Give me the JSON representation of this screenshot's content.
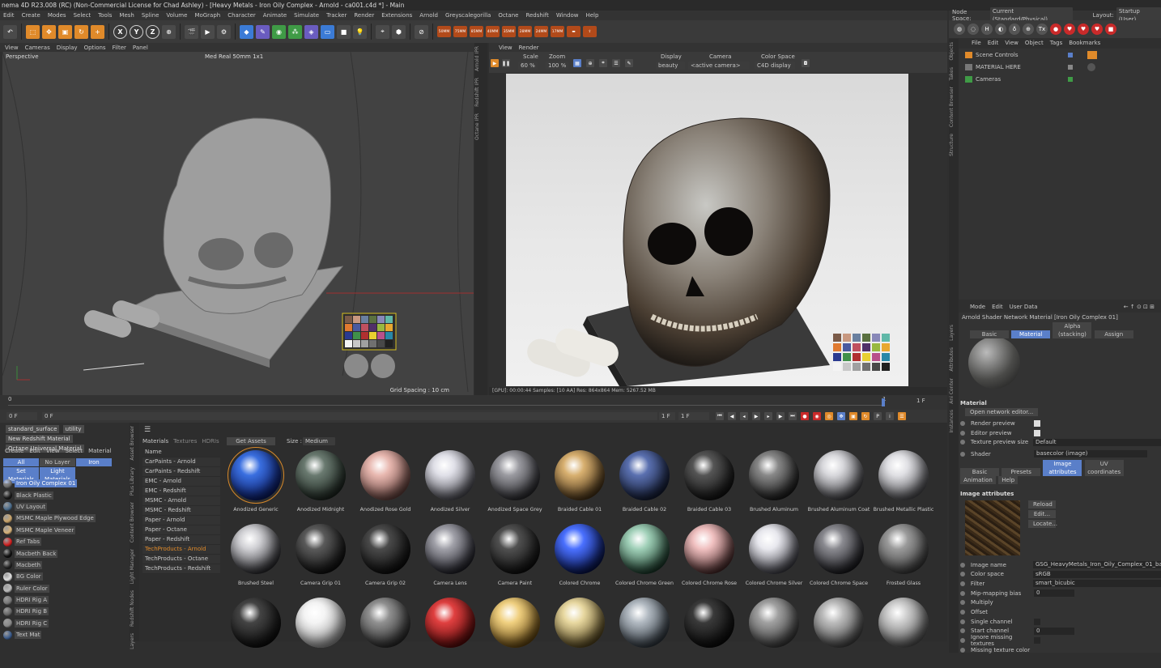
{
  "title": "nema 4D R23.008 (RC) (Non-Commercial License for Chad Ashley) - [Heavy Metals - Iron Oily Complex - Arnold - ca001.c4d *] - Main",
  "menu": [
    "Edit",
    "Create",
    "Modes",
    "Select",
    "Tools",
    "Mesh",
    "Spline",
    "Volume",
    "MoGraph",
    "Character",
    "Animate",
    "Simulate",
    "Tracker",
    "Render",
    "Extensions",
    "Arnold",
    "Greyscalegorilla",
    "Octane",
    "Redshift",
    "Window",
    "Help"
  ],
  "nodespace": {
    "label": "Node Space:",
    "value": "Current (Standard/Physical)",
    "layout_label": "Layout:",
    "layout_value": "Startup (User)"
  },
  "toolbar": {
    "axes": [
      "X",
      "Y",
      "Z"
    ],
    "render_presets": [
      "50MM",
      "75MM",
      "85MM",
      "40MM",
      "35MM",
      "28MM",
      "24MM",
      "17MM"
    ]
  },
  "viewport": {
    "menu": [
      "View",
      "Cameras",
      "Display",
      "Options",
      "Filter",
      "Panel"
    ],
    "label": "Perspective",
    "camera": "Med Real 50mm 1x1",
    "grid": "Grid Spacing : 10 cm"
  },
  "left_vtabs": [
    "Arnold IPR",
    "Redshift IPR",
    "Octane IPR"
  ],
  "render_view": {
    "menu": [
      "View",
      "Render"
    ],
    "scale_label": "Scale",
    "scale_value": "60 %",
    "zoom_label": "Zoom",
    "zoom_value": "100 %",
    "display_label": "Display",
    "display_value": "beauty",
    "camera_label": "Camera",
    "camera_value": "<active camera>",
    "colorspace_label": "Color Space",
    "colorspace_value": "C4D display",
    "status": "[GPU]: 00:00:44   Samples: [10 AA]   Res: 864x864   Mem: 5267.52 MB"
  },
  "timeline": {
    "start": "0",
    "end": "1",
    "frame_left": "0 F",
    "frame_l2": "0 F",
    "frame_r1": "1 F",
    "frame_r2": "1 F",
    "frame_top": "1 F"
  },
  "mm_top": {
    "chips": [
      "standard_surface",
      "utility",
      "New Redshift Material",
      "Octane Universal Material"
    ]
  },
  "mm_menu": [
    "Create",
    "Edit",
    "View",
    "Select",
    "Material"
  ],
  "mm_filter": {
    "row1": [
      "All",
      "No Layer",
      "Iron"
    ],
    "row2": [
      "Set Materials",
      "Light Materials"
    ]
  },
  "materials": [
    {
      "name": "Iron Oily Complex 01",
      "color": "#6b6b6b",
      "selected": true
    },
    {
      "name": "Black Plastic",
      "color": "#1a1a1a"
    },
    {
      "name": "UV Layout",
      "color": "#4a6b8a"
    },
    {
      "name": "MSMC Maple Plywood Edge",
      "color": "#c9a46a"
    },
    {
      "name": "MSMC Maple Veneer",
      "color": "#d8b47a"
    },
    {
      "name": "Ref Tabs",
      "color": "#d02020"
    },
    {
      "name": "Macbeth Back",
      "color": "#111111"
    },
    {
      "name": "Macbeth",
      "color": "#222222"
    },
    {
      "name": "BG Color",
      "color": "#e0e0e0"
    },
    {
      "name": "Ruler Color",
      "color": "#bbbbbb"
    },
    {
      "name": "HDRI Rig A",
      "color": "#777777"
    },
    {
      "name": "HDRI Rig B",
      "color": "#666666"
    },
    {
      "name": "HDRI Rig C",
      "color": "#888888"
    },
    {
      "name": "Text Mat",
      "color": "#3a5a8a"
    }
  ],
  "mm_vtabs": [
    "Asset Browser",
    "Plus Library",
    "Content Browser",
    "Light Manager",
    "Redshift Nodes",
    "Layers"
  ],
  "asset_browser": {
    "tabs": [
      "Materials",
      "Textures",
      "HDRIs"
    ],
    "get_assets": "Get Assets",
    "size_label": "Size :",
    "size_value": "Medium",
    "tree_header": "Name",
    "tree": [
      "CarPaints - Arnold",
      "CarPaints - Redshift",
      "EMC - Arnold",
      "EMC - Redshift",
      "MSMC - Arnold",
      "MSMC - Redshift",
      "Paper - Arnold",
      "Paper - Octane",
      "Paper - Redshift",
      "TechProducts - Arnold",
      "TechProducts - Octane",
      "TechProducts - Redshift"
    ],
    "tiles": [
      {
        "label": "Anodized Generic",
        "c1": "#3a6fe0",
        "c2": "#0a1a66"
      },
      {
        "label": "Anodized Midnight",
        "c1": "#6a7a70",
        "c2": "#1d2620"
      },
      {
        "label": "Anodized Rose Gold",
        "c1": "#e8b8b0",
        "c2": "#6a4540"
      },
      {
        "label": "Anodized Silver",
        "c1": "#e0e0e8",
        "c2": "#505058"
      },
      {
        "label": "Anodized Space Grey",
        "c1": "#9a9aa0",
        "c2": "#2a2a2e"
      },
      {
        "label": "Braided Cable 01",
        "c1": "#d8b070",
        "c2": "#4a3418"
      },
      {
        "label": "Braided Cable 02",
        "c1": "#5a70b0",
        "c2": "#141c34"
      },
      {
        "label": "Braided Cable 03",
        "c1": "#555555",
        "c2": "#111111"
      },
      {
        "label": "Brushed Aluminum",
        "c1": "#888888",
        "c2": "#1a1a1a"
      },
      {
        "label": "Brushed Aluminum Coat",
        "c1": "#d8d8dc",
        "c2": "#404044"
      },
      {
        "label": "Brushed Metallic Plastic",
        "c1": "#e0e0e4",
        "c2": "#505054"
      },
      {
        "label": "Brushed Steel",
        "c1": "#d0d0d4",
        "c2": "#2a2a2e"
      },
      {
        "label": "Camera Grip 01",
        "c1": "#5a5a5a",
        "c2": "#0e0e0e"
      },
      {
        "label": "Camera Grip 02",
        "c1": "#4a4a4a",
        "c2": "#0c0c0c"
      },
      {
        "label": "Camera Lens",
        "c1": "#a0a0a8",
        "c2": "#202028"
      },
      {
        "label": "Camera Paint",
        "c1": "#505050",
        "c2": "#0e0e0e"
      },
      {
        "label": "Colored Chrome",
        "c1": "#4a70ff",
        "c2": "#06124a"
      },
      {
        "label": "Colored Chrome Green",
        "c1": "#a0d0b8",
        "c2": "#1a3a2a"
      },
      {
        "label": "Colored Chrome Rose",
        "c1": "#f0c0c0",
        "c2": "#4a2a2a"
      },
      {
        "label": "Colored Chrome Silver",
        "c1": "#e8e8ee",
        "c2": "#404048"
      },
      {
        "label": "Colored Chrome Space",
        "c1": "#8a8a90",
        "c2": "#18181c"
      },
      {
        "label": "Frosted Glass",
        "c1": "#9a9a9a",
        "c2": "#3a3a3a"
      },
      {
        "label": "",
        "c1": "#444444",
        "c2": "#0c0c0c"
      },
      {
        "label": "",
        "c1": "#f4f4f4",
        "c2": "#9a9a9a"
      },
      {
        "label": "",
        "c1": "#909090",
        "c2": "#2a2a2a"
      },
      {
        "label": "",
        "c1": "#e04040",
        "c2": "#5a0a0a"
      },
      {
        "label": "",
        "c1": "#f0d080",
        "c2": "#6a4a10"
      },
      {
        "label": "",
        "c1": "#e8d8a0",
        "c2": "#5a4a20"
      },
      {
        "label": "",
        "c1": "#b0b8c0",
        "c2": "#303840"
      },
      {
        "label": "",
        "c1": "#3a3a3a",
        "c2": "#0a0a0a"
      },
      {
        "label": "",
        "c1": "#a0a0a0",
        "c2": "#3a3a3a"
      },
      {
        "label": "",
        "c1": "#bbbbbb",
        "c2": "#444444"
      },
      {
        "label": "",
        "c1": "#cccccc",
        "c2": "#555555"
      }
    ]
  },
  "objects": {
    "menu": [
      "File",
      "Edit",
      "View",
      "Object",
      "Tags",
      "Bookmarks"
    ],
    "items": [
      {
        "name": "Scene Controls",
        "icon": "#e08a2a"
      },
      {
        "name": "MATERIAL HERE",
        "icon": "#c9a46a"
      },
      {
        "name": "Cameras",
        "icon": "#3f9b46"
      }
    ]
  },
  "right_vtabs": [
    "Objects",
    "Takes",
    "Content Browser",
    "Structure",
    "Layers",
    "Attributes",
    "Ani Center",
    "Instances"
  ],
  "attributes": {
    "menu": [
      "Mode",
      "Edit",
      "User Data"
    ],
    "title": "Arnold Shader Network Material [Iron Oily Complex 01]",
    "tabs": [
      "Basic",
      "Material",
      "Alpha (stacking)",
      "Assign"
    ],
    "section": "Material",
    "open_network": "Open network editor...",
    "props1": [
      {
        "k": "Render preview",
        "check": true
      },
      {
        "k": "Editor preview",
        "check": true
      },
      {
        "k": "Texture preview size",
        "v": "Default"
      }
    ],
    "shader_label": "Shader",
    "shader_value": "basecolor (image)",
    "tabs2": [
      "Basic",
      "Presets",
      "Image attributes",
      "UV coordinates",
      "Animation",
      "Help"
    ],
    "img_section": "Image attributes",
    "img_buttons": [
      "Reload",
      "Edit...",
      "Locate..."
    ],
    "props2": [
      {
        "k": "Image name",
        "v": "GSG_HeavyMetals_Iron_Oily_Complex_01_basecolor.tx"
      },
      {
        "k": "Color space",
        "v": "sRGB"
      },
      {
        "k": "Filter",
        "v": "smart_bicubic"
      },
      {
        "k": "Mip-mapping bias",
        "v": "0"
      },
      {
        "k": "Multiply",
        "v": ""
      },
      {
        "k": "Offset",
        "v": ""
      },
      {
        "k": "Single channel",
        "v": ""
      },
      {
        "k": "Start channel",
        "v": "0"
      },
      {
        "k": "Ignore missing textures",
        "v": ""
      },
      {
        "k": "Missing texture color",
        "v": ""
      }
    ]
  },
  "colors": {
    "accent": "#5a7fc9",
    "orange": "#e08a2a",
    "red": "#c92a2a"
  }
}
